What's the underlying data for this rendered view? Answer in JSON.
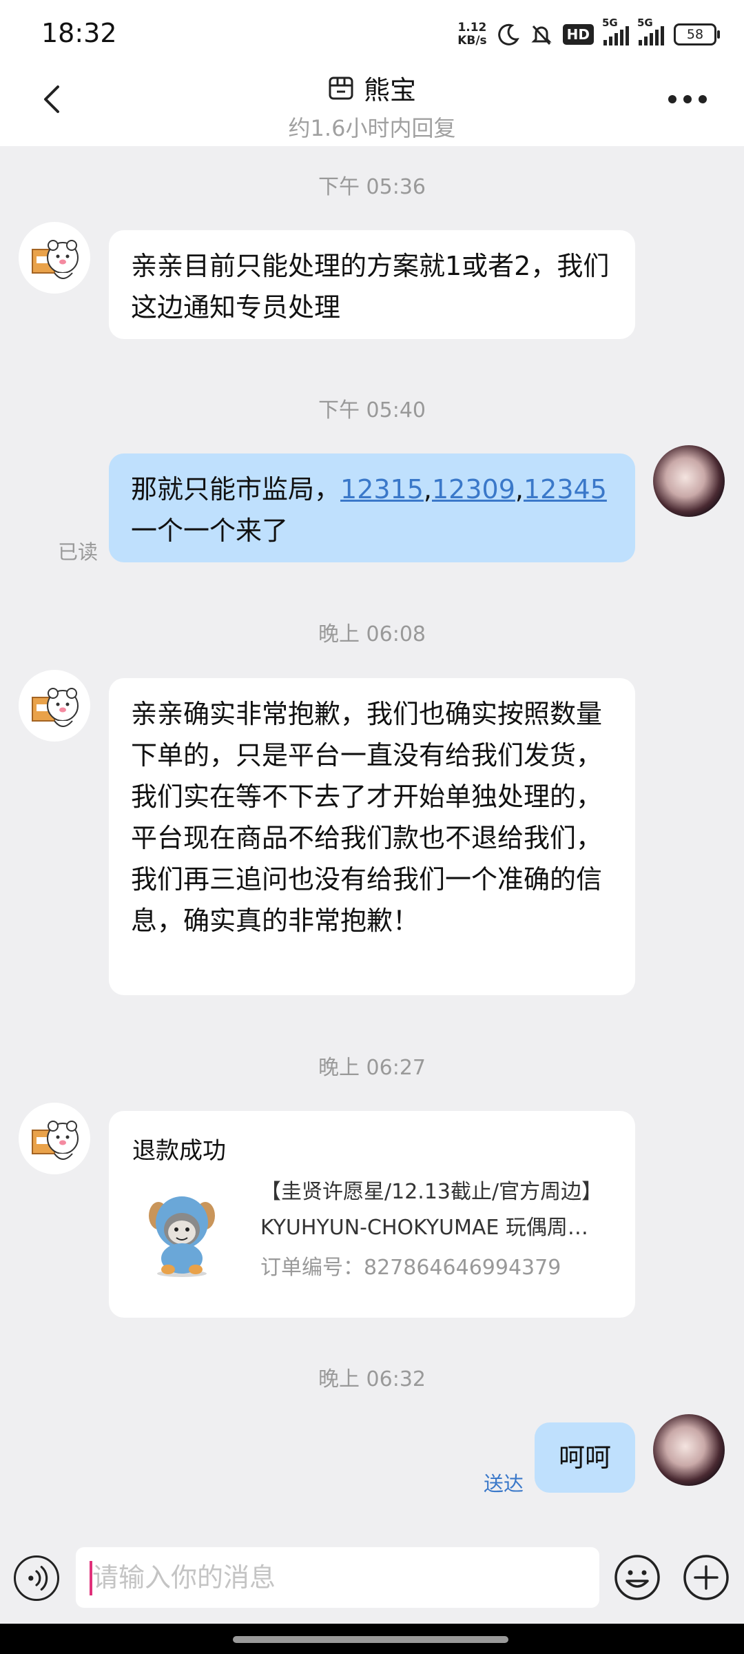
{
  "status_bar": {
    "time": "18:32",
    "net_speed_value": "1.12",
    "net_speed_unit": "KB/s",
    "hd_badge": "HD",
    "sim1_label": "5G",
    "sim2_label": "5G",
    "battery": "58",
    "icons": [
      "moon-icon",
      "mute-bell-icon",
      "signal-icon",
      "battery-icon"
    ]
  },
  "header": {
    "title": "熊宝",
    "subtitle": "约1.6小时内回复",
    "icons": [
      "back-arrow-icon",
      "shop-icon",
      "more-icon"
    ]
  },
  "messages": [
    {
      "type": "timestamp",
      "text": "下午 05:36"
    },
    {
      "type": "text",
      "side": "left",
      "text": "亲亲目前只能处理的方案就1或者2，我们这边通知专员处理"
    },
    {
      "type": "timestamp",
      "text": "下午 05:40"
    },
    {
      "type": "text",
      "side": "right",
      "text_before": "那就只能市监局，",
      "links": [
        "12315",
        "12309",
        "12345"
      ],
      "link_separator": ",",
      "text_after": "一个一个来了",
      "status": "已读"
    },
    {
      "type": "timestamp",
      "text": "晚上 06:08"
    },
    {
      "type": "text",
      "side": "left",
      "text": "亲亲确实非常抱歉，我们也确实按照数量下单的，只是平台一直没有给我们发货，我们实在等不下去了才开始单独处理的，平台现在商品不给我们款也不退给我们，我们再三追问也没有给我们一个准确的信息，确实真的非常抱歉！"
    },
    {
      "type": "timestamp",
      "text": "晚上 06:27"
    },
    {
      "type": "card",
      "side": "left",
      "title": "退款成功",
      "product_line1": "【圭贤许愿星/12.13截止/官方周边】",
      "product_line2": "KYUHYUN-CHOKYUMAE 玩偶周…",
      "order_label": "订单编号：",
      "order_number": "827864646994379"
    },
    {
      "type": "timestamp",
      "text": "晚上 06:32"
    },
    {
      "type": "text",
      "side": "right",
      "text": "呵呵",
      "status": "送达"
    }
  ],
  "input_bar": {
    "placeholder": "请输入你的消息",
    "icons": [
      "voice-icon",
      "emoji-icon",
      "plus-icon"
    ]
  },
  "colors": {
    "background": "#efeff1",
    "bubble_sent": "#bfe0fd",
    "bubble_received": "#ffffff",
    "link": "#3a78c9",
    "status_text": "#3a78c9",
    "timestamp": "#999999"
  }
}
